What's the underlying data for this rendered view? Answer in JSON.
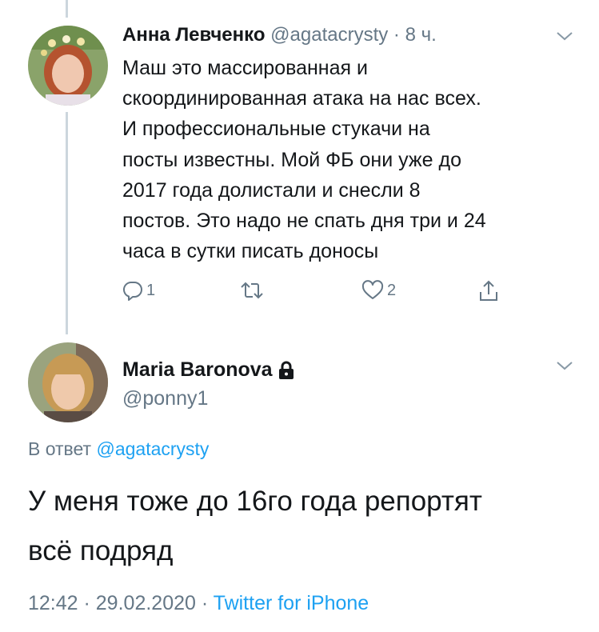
{
  "tweet1": {
    "author_name": "Анна Левченко",
    "handle": "@agatacrysty",
    "separator": " · ",
    "time": "8 ч.",
    "text": "Маш это массированная и\nскоординированная атака на нас всех.\nИ профессиональные стукачи на\nпосты известны. Мой ФБ они уже до\n2017 года долистали и снесли 8\nпостов. Это надо не спать дня три и 24\nчаса в сутки писать доносы",
    "reply_count": "1",
    "like_count": "2",
    "icons": [
      "reply-icon",
      "retweet-icon",
      "like-icon",
      "share-icon",
      "chevron-down-icon"
    ]
  },
  "tweet2": {
    "author_name": "Maria Baronova",
    "handle": "@ponny1",
    "reply_prefix": "В ответ ",
    "reply_mention": "@agatacrysty",
    "text": "У меня тоже до 16го года репортят\nвсё подряд",
    "time": "12:42",
    "separator1": " · ",
    "date": "29.02.2020",
    "separator2": " · ",
    "source": "Twitter for iPhone",
    "icons": [
      "lock-icon",
      "chevron-down-icon"
    ]
  },
  "colors": {
    "text": "#14171a",
    "secondary": "#657786",
    "link": "#1da1f2",
    "thread_line": "#ccd6dd"
  }
}
